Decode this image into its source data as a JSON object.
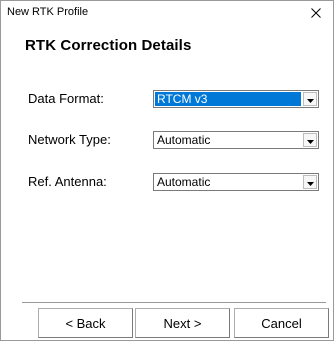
{
  "window": {
    "title": "New RTK Profile"
  },
  "heading": "RTK Correction Details",
  "fields": [
    {
      "label": "Data Format:",
      "value": "RTCM v3"
    },
    {
      "label": "Network Type:",
      "value": "Automatic"
    },
    {
      "label": "Ref. Antenna:",
      "value": "Automatic"
    }
  ],
  "buttons": {
    "back": "< Back",
    "next": "Next >",
    "cancel": "Cancel"
  },
  "colors": {
    "selection": "#0078d7"
  },
  "icons": {
    "close": "close-icon",
    "dropdown": "chevron-down-icon"
  }
}
